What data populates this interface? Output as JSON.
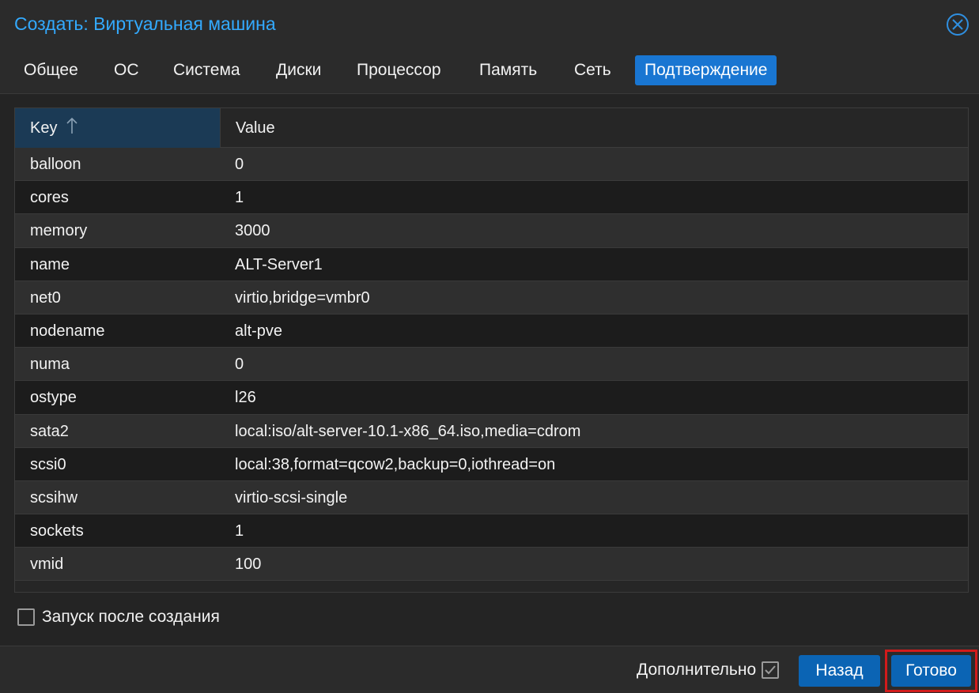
{
  "window": {
    "title": "Создать: Виртуальная машина",
    "close_icon": "close-circle-icon",
    "accent_color": "#33aaff"
  },
  "tabs": [
    {
      "label": "Общее"
    },
    {
      "label": "ОС"
    },
    {
      "label": "Система"
    },
    {
      "label": "Диски"
    },
    {
      "label": "Процессор"
    },
    {
      "label": "Память"
    },
    {
      "label": "Сеть"
    },
    {
      "label": "Подтверждение",
      "active": true
    }
  ],
  "grid": {
    "columns": {
      "key": "Key",
      "value": "Value"
    },
    "sort": {
      "column": "Key",
      "direction": "ascending",
      "icon": "arrow-up-icon"
    },
    "rows": [
      {
        "key": "balloon",
        "value": "0"
      },
      {
        "key": "cores",
        "value": "1"
      },
      {
        "key": "memory",
        "value": "3000"
      },
      {
        "key": "name",
        "value": "ALT-Server1"
      },
      {
        "key": "net0",
        "value": "virtio,bridge=vmbr0"
      },
      {
        "key": "nodename",
        "value": "alt-pve"
      },
      {
        "key": "numa",
        "value": "0"
      },
      {
        "key": "ostype",
        "value": "l26"
      },
      {
        "key": "sata2",
        "value": "local:iso/alt-server-10.1-x86_64.iso,media=cdrom"
      },
      {
        "key": "scsi0",
        "value": "local:38,format=qcow2,backup=0,iothread=on"
      },
      {
        "key": "scsihw",
        "value": "virtio-scsi-single"
      },
      {
        "key": "sockets",
        "value": "1"
      },
      {
        "key": "vmid",
        "value": "100"
      }
    ]
  },
  "start_after_create": {
    "label": "Запуск после создания",
    "checked": false
  },
  "footer": {
    "advanced_label": "Дополнительно",
    "advanced_checked": true,
    "back_label": "Назад",
    "done_label": "Готово",
    "button_color": "#0b64b4",
    "highlight_color": "#d21b1b"
  }
}
